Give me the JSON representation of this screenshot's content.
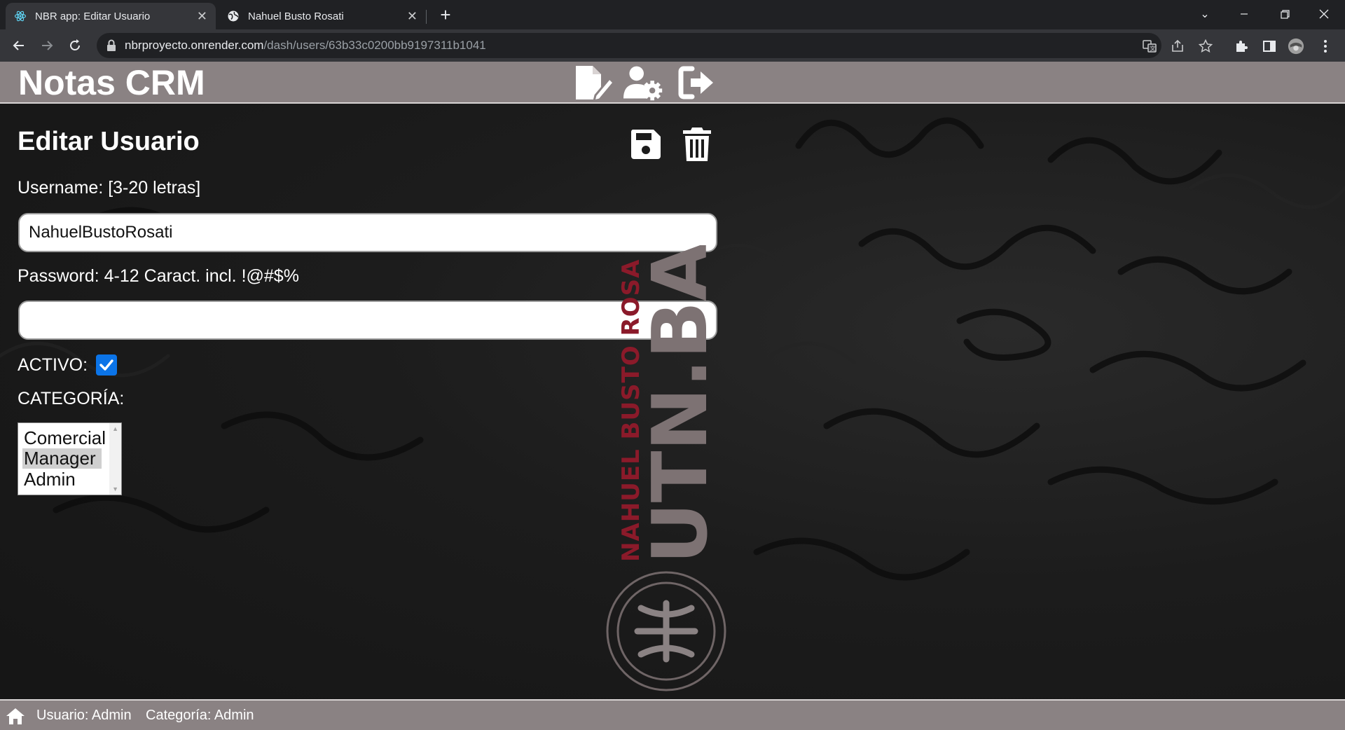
{
  "browser": {
    "tabs": [
      {
        "title": "NBR app: Editar Usuario",
        "active": true
      },
      {
        "title": "Nahuel Busto Rosati",
        "active": false
      }
    ],
    "url_host": "nbrproyecto.onrender.com",
    "url_path": "/dash/users/63b33c0200bb9197311b1041"
  },
  "app": {
    "title": "Notas CRM"
  },
  "form": {
    "title": "Editar Usuario",
    "username_label": "Username: [3-20 letras]",
    "username_value": "NahuelBustoRosati",
    "password_label": "Password: 4-12 Caract. incl. !@#$%",
    "password_value": "",
    "active_label": "ACTIVO:",
    "active_checked": true,
    "category_label": "CATEGORÍA:",
    "category_options": [
      "Comercial",
      "Manager",
      "Admin"
    ],
    "category_selected": "Manager"
  },
  "watermark": {
    "name": "NAHUEL BUSTO ROSA",
    "brand": "UTN.BA"
  },
  "footer": {
    "user": "Usuario: Admin",
    "category": "Categoría: Admin"
  },
  "colors": {
    "header_bg": "#8a8283",
    "checkbox_accent": "#0b74e8",
    "watermark_red": "#8b1a2a",
    "watermark_grey": "#7d7273"
  }
}
